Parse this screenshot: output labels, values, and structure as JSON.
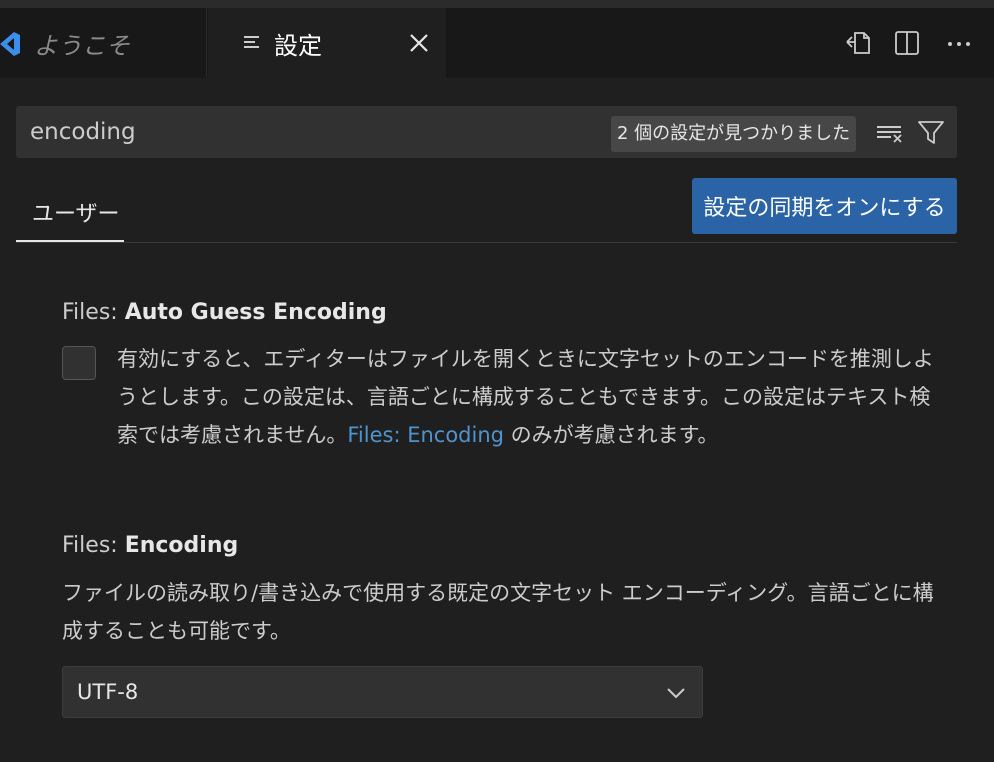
{
  "tabs": {
    "welcome_label": "ようこそ",
    "settings_label": "設定"
  },
  "search": {
    "value": "encoding",
    "result_count": "2 個の設定が見つかりました"
  },
  "scope": {
    "user_tab": "ユーザー"
  },
  "sync_button": "設定の同期をオンにする",
  "settings": [
    {
      "category": "Files: ",
      "name": "Auto Guess Encoding",
      "desc_before_link": "有効にすると、エディターはファイルを開くときに文字セットのエンコードを推測しようとします。この設定は、言語ごとに構成することもできます。この設定はテキスト検索では考慮されません。",
      "desc_link": "Files: Encoding",
      "desc_after_link": " のみが考慮されます。",
      "checked": false
    },
    {
      "category": "Files: ",
      "name": "Encoding",
      "desc": "ファイルの読み取り/書き込みで使用する既定の文字セット エンコーディング。言語ごとに構成することも可能です。",
      "selected": "UTF-8"
    }
  ],
  "colors": {
    "accent_button": "#2b64a6",
    "link": "#4e94ce",
    "vscode_logo": "#3b8eea"
  }
}
